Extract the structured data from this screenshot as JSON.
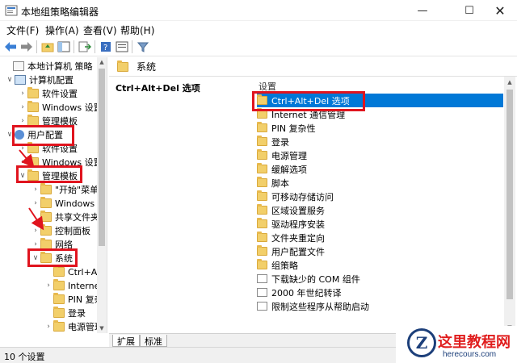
{
  "window": {
    "title": "本地组策略编辑器"
  },
  "menu": [
    "文件(F)",
    "操作(A)",
    "查看(V)",
    "帮助(H)"
  ],
  "tree": [
    {
      "label": "本地计算机 策略",
      "arrow": "",
      "icon": "policy"
    },
    {
      "label": "计算机配置",
      "arrow": "∨",
      "icon": "computer"
    },
    {
      "label": "软件设置",
      "arrow": "›",
      "icon": "folder"
    },
    {
      "label": "Windows 设置",
      "arrow": "›",
      "icon": "folder"
    },
    {
      "label": "管理模板",
      "arrow": "›",
      "icon": "folder"
    },
    {
      "label": "用户配置",
      "arrow": "∨",
      "icon": "user"
    },
    {
      "label": "软件设置",
      "arrow": "›",
      "icon": "folder"
    },
    {
      "label": "Windows 设置",
      "arrow": "›",
      "icon": "folder"
    },
    {
      "label": "管理模板",
      "arrow": "∨",
      "icon": "folder"
    },
    {
      "label": "\"开始\"菜单和任务栏",
      "arrow": "›",
      "icon": "folder"
    },
    {
      "label": "Windows 组件",
      "arrow": "›",
      "icon": "folder"
    },
    {
      "label": "共享文件夹",
      "arrow": "",
      "icon": "folder"
    },
    {
      "label": "控制面板",
      "arrow": "›",
      "icon": "folder"
    },
    {
      "label": "网络",
      "arrow": "›",
      "icon": "folder"
    },
    {
      "label": "系统",
      "arrow": "∨",
      "icon": "folder"
    },
    {
      "label": "Ctrl+Alt+Del 选项",
      "arrow": "",
      "icon": "folder"
    },
    {
      "label": "Internet 通信管理",
      "arrow": "›",
      "icon": "folder"
    },
    {
      "label": "PIN 复杂性",
      "arrow": "",
      "icon": "folder"
    },
    {
      "label": "登录",
      "arrow": "",
      "icon": "folder"
    },
    {
      "label": "电源管理",
      "arrow": "›",
      "icon": "folder"
    }
  ],
  "right": {
    "header_title": "系统",
    "description_title": "Ctrl+Alt+Del 选项",
    "column_header": "设置",
    "items": [
      {
        "label": "Ctrl+Alt+Del 选项",
        "icon": "folder",
        "selected": true
      },
      {
        "label": "Internet 通信管理",
        "icon": "folder",
        "selected": false
      },
      {
        "label": "PIN 复杂性",
        "icon": "folder",
        "selected": false
      },
      {
        "label": "登录",
        "icon": "folder",
        "selected": false
      },
      {
        "label": "电源管理",
        "icon": "folder",
        "selected": false
      },
      {
        "label": "缓解选项",
        "icon": "folder",
        "selected": false
      },
      {
        "label": "脚本",
        "icon": "folder",
        "selected": false
      },
      {
        "label": "可移动存储访问",
        "icon": "folder",
        "selected": false
      },
      {
        "label": "区域设置服务",
        "icon": "folder",
        "selected": false
      },
      {
        "label": "驱动程序安装",
        "icon": "folder",
        "selected": false
      },
      {
        "label": "文件夹重定向",
        "icon": "folder",
        "selected": false
      },
      {
        "label": "用户配置文件",
        "icon": "folder",
        "selected": false
      },
      {
        "label": "组策略",
        "icon": "folder",
        "selected": false
      },
      {
        "label": "下载缺少的 COM 组件",
        "icon": "policy",
        "selected": false
      },
      {
        "label": "2000 年世纪转译",
        "icon": "policy",
        "selected": false
      },
      {
        "label": "限制这些程序从帮助启动",
        "icon": "policy",
        "selected": false
      }
    ]
  },
  "tabs": [
    "扩展",
    "标准"
  ],
  "status": {
    "text": "10 个设置"
  },
  "watermark": {
    "title": "这里教程网",
    "url": "herecours.com",
    "logo_letter": "Z"
  },
  "colors": {
    "selection": "#0078d7",
    "highlight_box": "#e0141e",
    "folder": "#f2cf6a"
  }
}
